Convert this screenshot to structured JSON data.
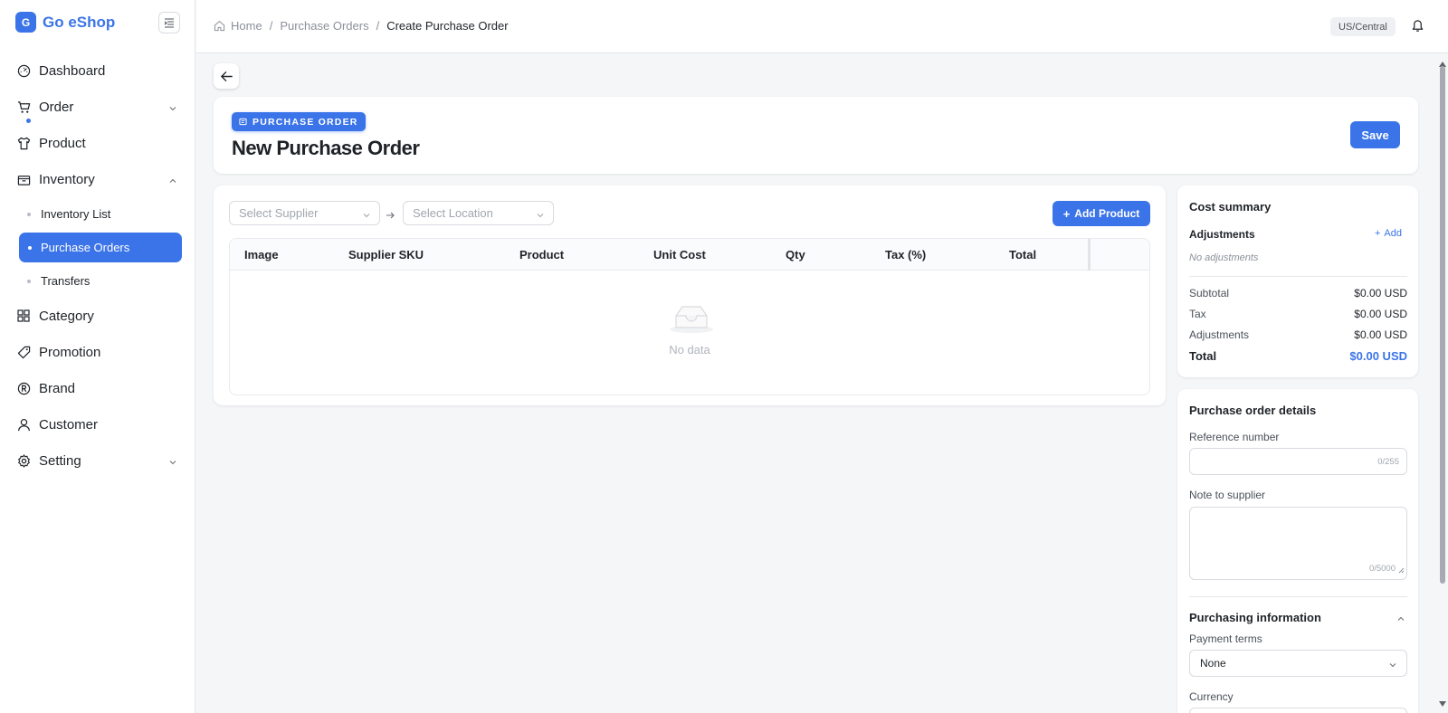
{
  "app": {
    "name": "Go eShop",
    "logo_letter": "G",
    "accent": "#3b74e8"
  },
  "sidebar": {
    "items": [
      {
        "label": "Dashboard",
        "icon": "dashboard-icon"
      },
      {
        "label": "Order",
        "icon": "cart-icon"
      },
      {
        "label": "Product",
        "icon": "shirt-icon"
      },
      {
        "label": "Inventory",
        "icon": "inventory-icon"
      },
      {
        "label": "Category",
        "icon": "grid-icon"
      },
      {
        "label": "Promotion",
        "icon": "tag-icon"
      },
      {
        "label": "Brand",
        "icon": "registered-icon"
      },
      {
        "label": "Customer",
        "icon": "user-icon"
      },
      {
        "label": "Setting",
        "icon": "gear-icon"
      }
    ],
    "inventory_sub": [
      "Inventory List",
      "Purchase Orders",
      "Transfers"
    ],
    "active_sub": "Purchase Orders"
  },
  "header": {
    "breadcrumb": [
      "Home",
      "Purchase Orders",
      "Create Purchase Order"
    ],
    "timezone": "US/Central"
  },
  "page": {
    "badge": "PURCHASE ORDER",
    "title": "New Purchase Order",
    "save_label": "Save"
  },
  "products": {
    "supplier_placeholder": "Select Supplier",
    "location_placeholder": "Select Location",
    "add_product_label": "Add Product",
    "columns": [
      "Image",
      "Supplier SKU",
      "Product",
      "Unit Cost",
      "Qty",
      "Tax (%)",
      "Total"
    ],
    "empty_text": "No data"
  },
  "cost_summary": {
    "title": "Cost summary",
    "adjustments_label": "Adjustments",
    "add_label": "Add",
    "no_adjustments": "No adjustments",
    "rows": [
      {
        "label": "Subtotal",
        "value": "$0.00 USD"
      },
      {
        "label": "Tax",
        "value": "$0.00 USD"
      },
      {
        "label": "Adjustments",
        "value": "$0.00 USD"
      }
    ],
    "total_label": "Total",
    "total_value": "$0.00 USD"
  },
  "details": {
    "title": "Purchase order details",
    "reference_label": "Reference number",
    "reference_counter": "0/255",
    "note_label": "Note to supplier",
    "note_counter": "0/5000",
    "purchasing_title": "Purchasing information",
    "payment_terms_label": "Payment terms",
    "payment_terms_value": "None",
    "currency_label": "Currency"
  }
}
